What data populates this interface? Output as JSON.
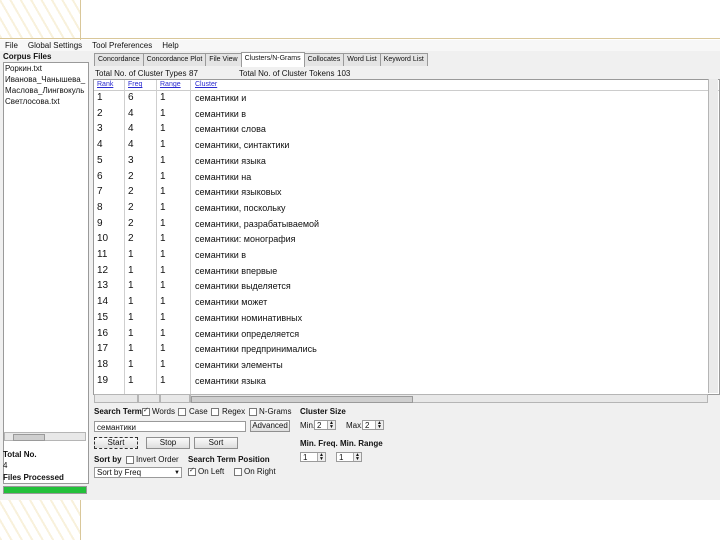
{
  "menu": [
    "File",
    "Global Settings",
    "Tool Preferences",
    "Help"
  ],
  "corpus": {
    "title": "Corpus Files",
    "files": [
      "Роркин.txt",
      "Иванова_Чанышева_",
      "Маслова_Лингвокуль",
      "Светлосова.txt"
    ]
  },
  "stats": {
    "total_label": "Total No.",
    "total_value": "4",
    "processed_label": "Files Processed",
    "progress": 1.0
  },
  "tabs": [
    {
      "label": "Concordance",
      "active": false
    },
    {
      "label": "Concordance Plot",
      "active": false
    },
    {
      "label": "File View",
      "active": false
    },
    {
      "label": "Clusters/N-Grams",
      "active": true
    },
    {
      "label": "Collocates",
      "active": false
    },
    {
      "label": "Word List",
      "active": false
    },
    {
      "label": "Keyword List",
      "active": false
    }
  ],
  "totals": {
    "types_label": "Total No. of Cluster Types",
    "types_value": "87",
    "tokens_label": "Total No. of Cluster Tokens",
    "tokens_value": "103"
  },
  "table": {
    "headers": {
      "rank": "Rank",
      "freq": "Freq",
      "range": "Range",
      "cluster": "Cluster"
    },
    "rows": [
      {
        "rank": "1",
        "freq": "6",
        "range": "1",
        "cluster": "семантики и"
      },
      {
        "rank": "2",
        "freq": "4",
        "range": "1",
        "cluster": "семантики в"
      },
      {
        "rank": "3",
        "freq": "4",
        "range": "1",
        "cluster": "семантики слова"
      },
      {
        "rank": "4",
        "freq": "4",
        "range": "1",
        "cluster": "семантики, синтактики"
      },
      {
        "rank": "5",
        "freq": "3",
        "range": "1",
        "cluster": "семантики языка"
      },
      {
        "rank": "6",
        "freq": "2",
        "range": "1",
        "cluster": "семантики на"
      },
      {
        "rank": "7",
        "freq": "2",
        "range": "1",
        "cluster": "семантики языковых"
      },
      {
        "rank": "8",
        "freq": "2",
        "range": "1",
        "cluster": "семантики, поскольку"
      },
      {
        "rank": "9",
        "freq": "2",
        "range": "1",
        "cluster": "семантики, разрабатываемой"
      },
      {
        "rank": "10",
        "freq": "2",
        "range": "1",
        "cluster": "семантики: монография"
      },
      {
        "rank": "11",
        "freq": "1",
        "range": "1",
        "cluster": "семантики в"
      },
      {
        "rank": "12",
        "freq": "1",
        "range": "1",
        "cluster": "семантики впервые"
      },
      {
        "rank": "13",
        "freq": "1",
        "range": "1",
        "cluster": "семантики выделяется"
      },
      {
        "rank": "14",
        "freq": "1",
        "range": "1",
        "cluster": "семантики может"
      },
      {
        "rank": "15",
        "freq": "1",
        "range": "1",
        "cluster": "семантики номинативных"
      },
      {
        "rank": "16",
        "freq": "1",
        "range": "1",
        "cluster": "семантики определяется"
      },
      {
        "rank": "17",
        "freq": "1",
        "range": "1",
        "cluster": "семантики предпринимались"
      },
      {
        "rank": "18",
        "freq": "1",
        "range": "1",
        "cluster": "семантики элементы"
      },
      {
        "rank": "19",
        "freq": "1",
        "range": "1",
        "cluster": "семантики языка"
      }
    ]
  },
  "search": {
    "label": "Search Term",
    "words_label": "Words",
    "case_label": "Case",
    "regex_label": "Regex",
    "ngrams_label": "N-Grams",
    "term_value": "семантики",
    "advanced_label": "Advanced",
    "start_label": "Start",
    "stop_label": "Stop",
    "sort_label": "Sort"
  },
  "cluster_size": {
    "label": "Cluster Size",
    "min_label": "Min.",
    "min_value": "2",
    "max_label": "Max.",
    "max_value": "2"
  },
  "min_freq": {
    "label": "Min. Freq.",
    "value": "1"
  },
  "min_range": {
    "label": "Min. Range",
    "value": "1"
  },
  "sort": {
    "label": "Sort by",
    "invert_label": "Invert Order",
    "value": "Sort by Freq"
  },
  "position": {
    "label": "Search Term Position",
    "left_label": "On Left",
    "right_label": "On Right"
  }
}
